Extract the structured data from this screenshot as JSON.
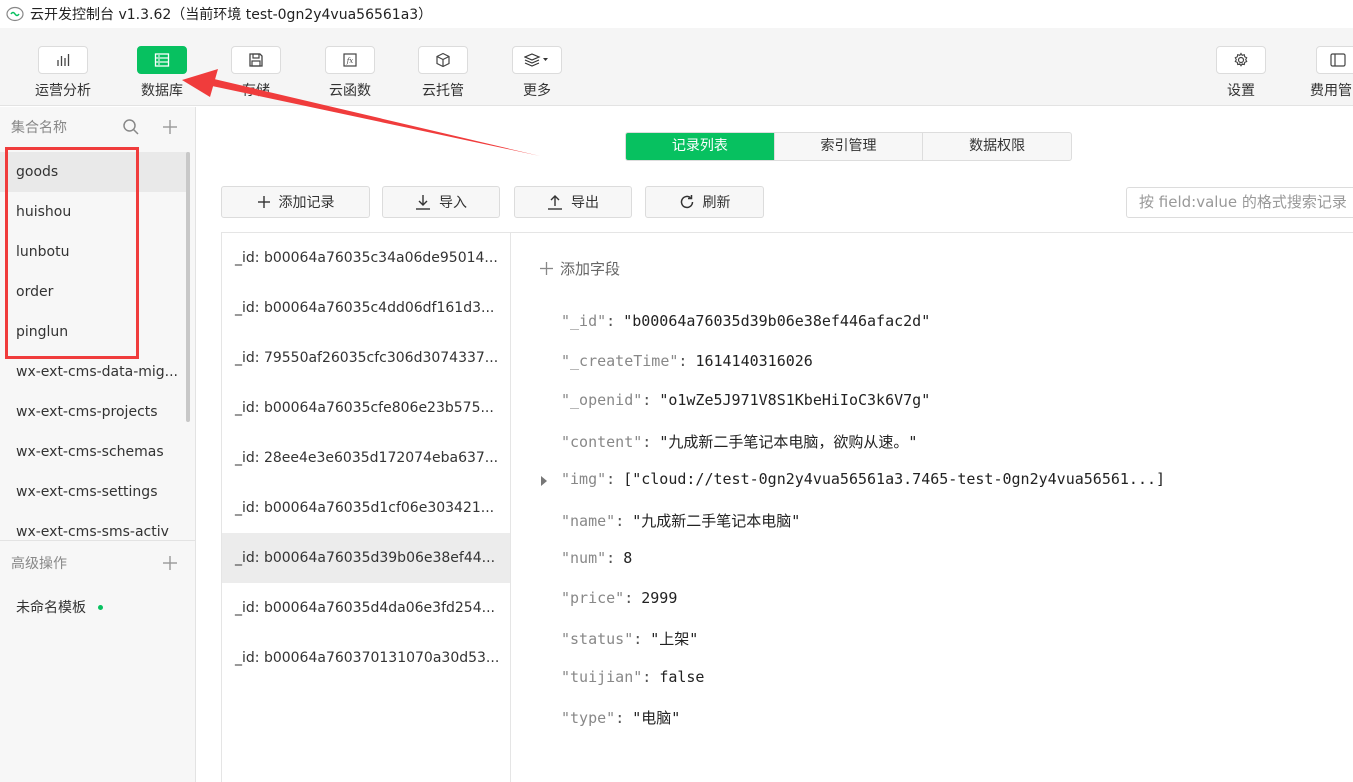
{
  "window": {
    "title": "云开发控制台 v1.3.62（当前环境 test-0gn2y4vua56561a3）"
  },
  "toolbar": {
    "items": [
      {
        "label": "运营分析",
        "icon": "bar-chart-icon"
      },
      {
        "label": "数据库",
        "icon": "database-icon"
      },
      {
        "label": "存储",
        "icon": "storage-icon"
      },
      {
        "label": "云函数",
        "icon": "function-icon"
      },
      {
        "label": "云托管",
        "icon": "cube-icon"
      },
      {
        "label": "更多",
        "icon": "layers-icon"
      }
    ],
    "settings": "设置",
    "billing": "费用管"
  },
  "sidebar": {
    "collection_header": "集合名称",
    "collections": [
      "goods",
      "huishou",
      "lunbotu",
      "order",
      "pinglun",
      "wx-ext-cms-data-mig...",
      "wx-ext-cms-projects",
      "wx-ext-cms-schemas",
      "wx-ext-cms-settings",
      "wx-ext-cms-sms-activ"
    ],
    "advanced_header": "高级操作",
    "template_item": "未命名模板"
  },
  "tabs": [
    "记录列表",
    "索引管理",
    "数据权限"
  ],
  "actions": {
    "add": "添加记录",
    "import": "导入",
    "export": "导出",
    "refresh": "刷新",
    "search_placeholder": "按 field:value 的格式搜索记录"
  },
  "records": [
    "_id: b00064a76035c34a06de95014...",
    "_id: b00064a76035c4dd06df161d3...",
    "_id: 79550af26035cfc306d3074337...",
    "_id: b00064a76035cfe806e23b575...",
    "_id: 28ee4e3e6035d172074eba637...",
    "_id: b00064a76035d1cf06e303421...",
    "_id: b00064a76035d39b06e38ef44...",
    "_id: b00064a76035d4da06e3fd254...",
    "_id: b00064a760370131070a30d53..."
  ],
  "detail": {
    "add_field": "添加字段",
    "fields": [
      {
        "key": "\"_id\"",
        "value": "\"b00064a76035d39b06e38ef446afac2d\""
      },
      {
        "key": "\"_createTime\"",
        "value": "1614140316026"
      },
      {
        "key": "\"_openid\"",
        "value": "\"o1wZe5J971V8S1KbeHiIoC3k6V7g\""
      },
      {
        "key": "\"content\"",
        "value": "\"九成新二手笔记本电脑，欲购从速。\""
      },
      {
        "key": "\"img\"",
        "value": "[\"cloud://test-0gn2y4vua56561a3.7465-test-0gn2y4vua56561...]"
      },
      {
        "key": "\"name\"",
        "value": "\"九成新二手笔记本电脑\""
      },
      {
        "key": "\"num\"",
        "value": "8"
      },
      {
        "key": "\"price\"",
        "value": "2999"
      },
      {
        "key": "\"status\"",
        "value": "\"上架\""
      },
      {
        "key": "\"tuijian\"",
        "value": "false"
      },
      {
        "key": "\"type\"",
        "value": "\"电脑\""
      }
    ]
  },
  "colors": {
    "accent": "#07c160",
    "annotation": "#f03c3c"
  }
}
